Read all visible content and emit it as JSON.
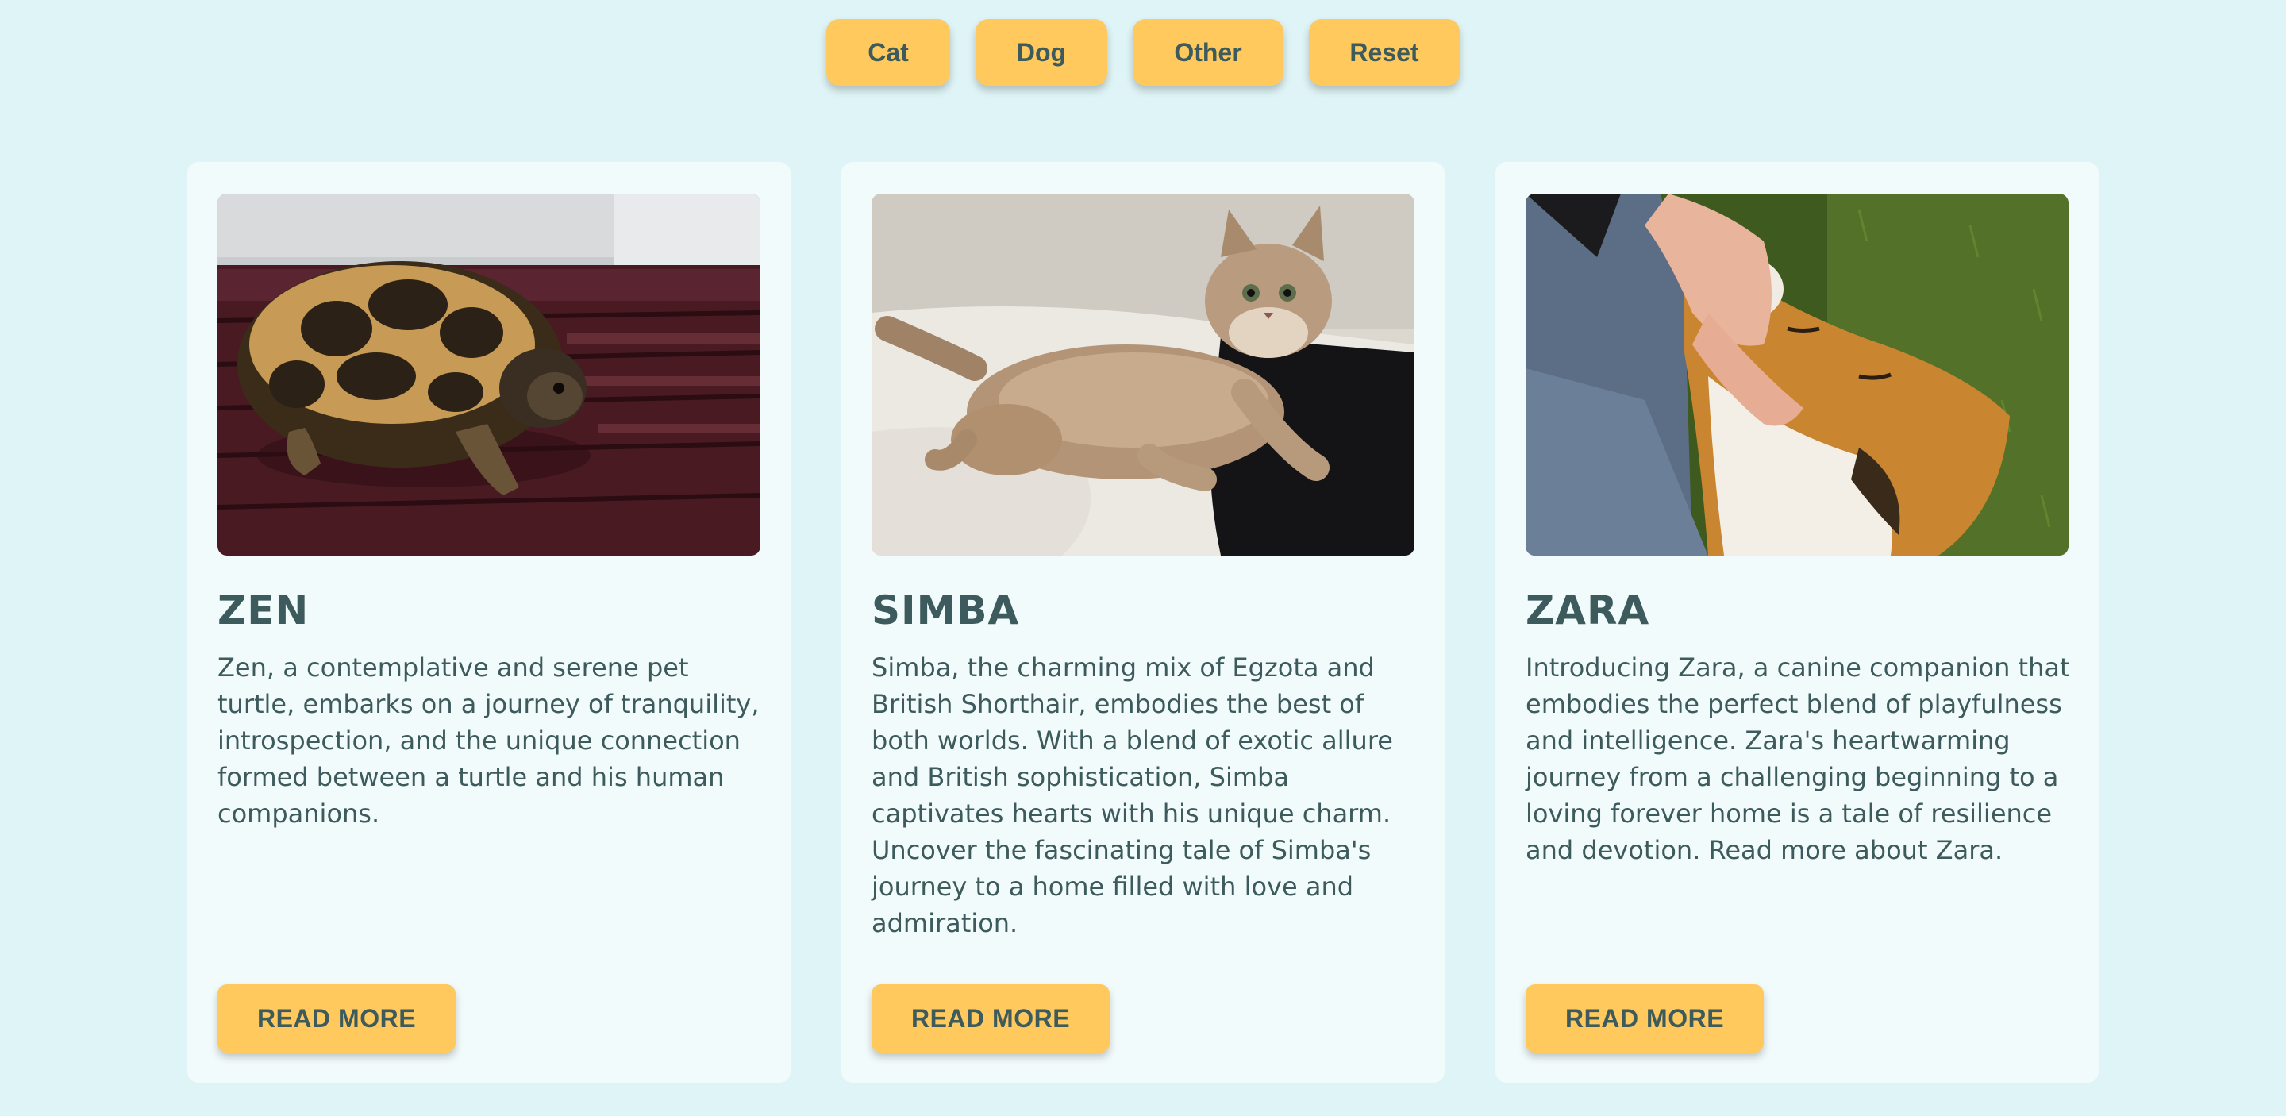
{
  "filters": {
    "cat_label": "Cat",
    "dog_label": "Dog",
    "other_label": "Other",
    "reset_label": "Reset"
  },
  "cards": [
    {
      "name": "ZEN",
      "image": "turtle-photo",
      "description": "Zen, a contemplative and serene pet turtle, embarks on a journey of tranquility, introspection, and the unique connection formed between a turtle and his human companions.",
      "button_label": "READ MORE"
    },
    {
      "name": "SIMBA",
      "image": "cat-photo",
      "description": "Simba, the charming mix of Egzota and British Shorthair, embodies the best of both worlds. With a blend of exotic allure and British sophistication, Simba captivates hearts with his unique charm. Uncover the fascinating tale of Simba's journey to a home filled with love and admiration.",
      "button_label": "READ MORE"
    },
    {
      "name": "ZARA",
      "image": "dog-photo",
      "description": "Introducing Zara, a canine companion that embodies the perfect blend of playfulness and intelligence. Zara's heartwarming journey from a challenging beginning to a loving forever home is a tale of resilience and devotion. Read more about Zara.",
      "button_label": "READ MORE"
    }
  ],
  "colors": {
    "page_background": "#dff4f6",
    "card_background": "#f2fbfb",
    "button_accent": "#ffc95e",
    "text": "#3d5b5c"
  }
}
